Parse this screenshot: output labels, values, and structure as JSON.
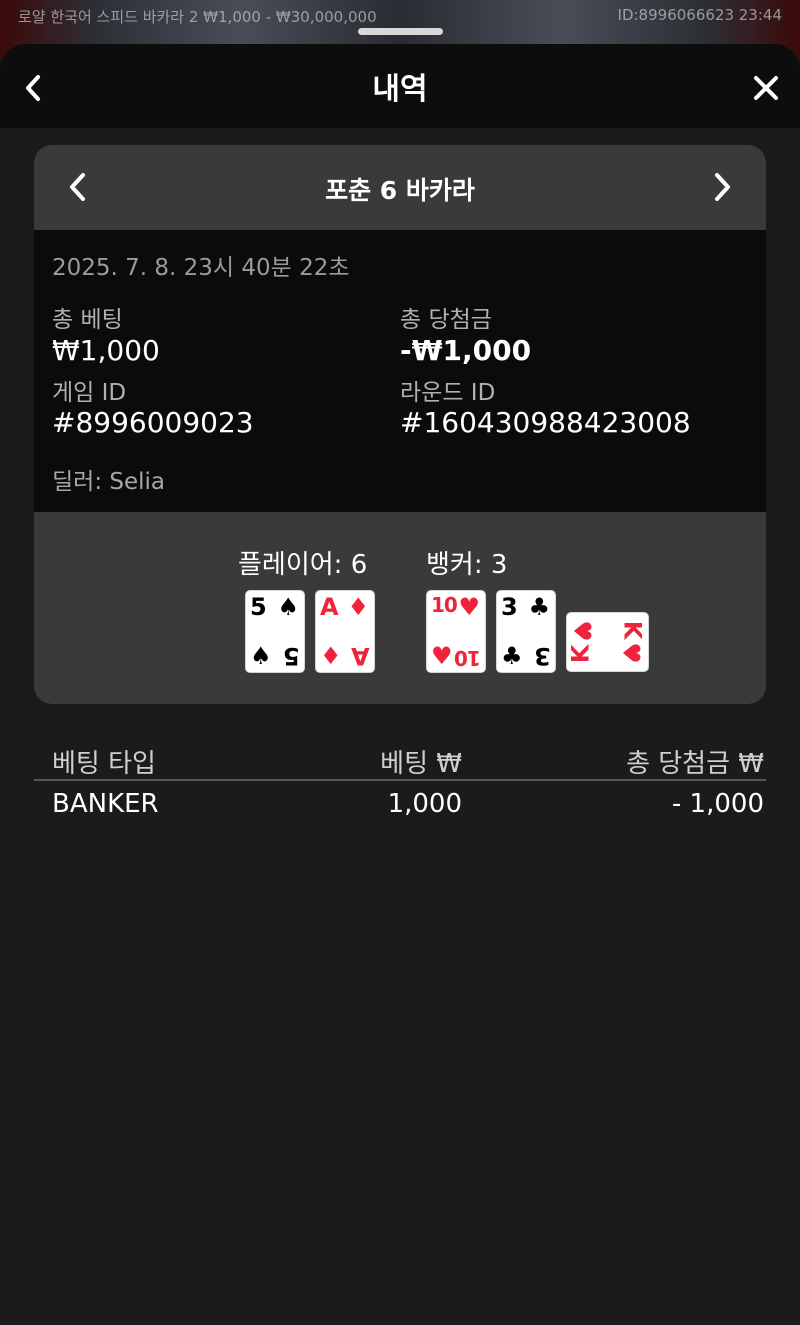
{
  "status_bar": {
    "table_info": "로얄 한국어 스피드 바카라 2  ₩1,000 - ₩30,000,000",
    "player_id_time": "ID:8996066623  23:44"
  },
  "sheet": {
    "title": "내역"
  },
  "round": {
    "game_name": "포춘 6 바카라",
    "datetime": "2025. 7. 8. 23시 40분 22초",
    "total_bet_label": "총 베팅",
    "total_bet_value": "₩1,000",
    "total_win_label": "총 당첨금",
    "total_win_value": "-₩1,000",
    "game_id_label": "게임 ID",
    "game_id_value": "#8996009023",
    "round_id_label": "라운드 ID",
    "round_id_value": "#160430988423008",
    "dealer": "딜러: Selia",
    "player_label": "플레이어: 6",
    "banker_label": "뱅커: 3",
    "player_cards": [
      {
        "rank": "5",
        "suit": "♠",
        "color": "#000000"
      },
      {
        "rank": "A",
        "suit": "♦",
        "color": "#f0233c"
      }
    ],
    "banker_cards": [
      {
        "rank": "10",
        "suit": "♥",
        "color": "#f0233c"
      },
      {
        "rank": "3",
        "suit": "♣",
        "color": "#000000"
      },
      {
        "rank": "K",
        "suit": "♥",
        "color": "#f0233c"
      }
    ]
  },
  "bets_table": {
    "headers": [
      "베팅 타입",
      "베팅 ₩",
      "총 당첨금 ₩"
    ],
    "rows": [
      {
        "type": "BANKER",
        "bet": "1,000",
        "win": "- 1,000"
      }
    ]
  }
}
